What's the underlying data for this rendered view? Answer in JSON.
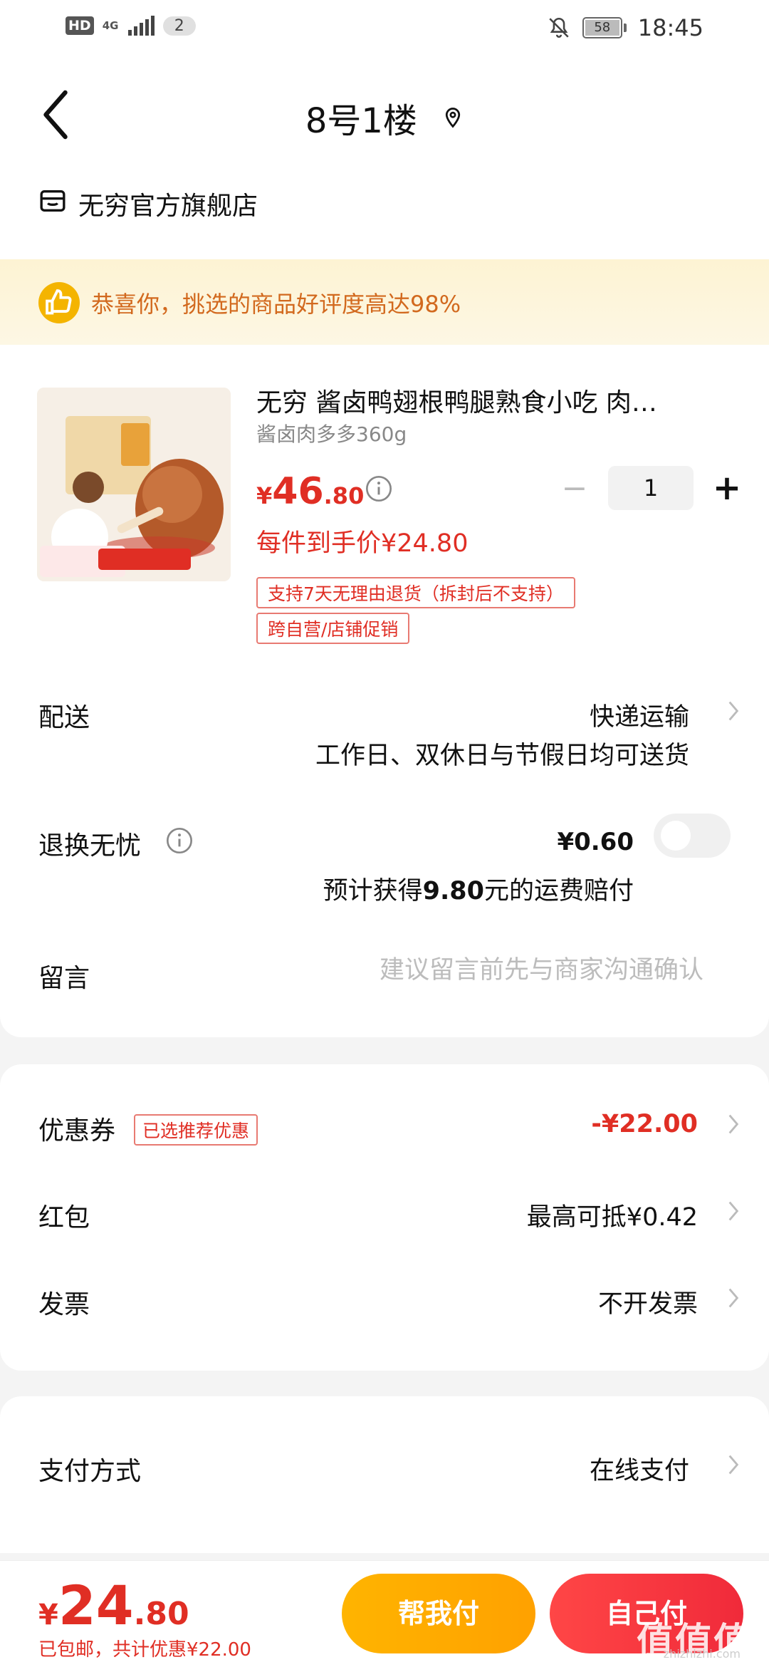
{
  "status_bar": {
    "hd": "HD",
    "network": "4G",
    "notif_count": "2",
    "battery": "58",
    "time": "18:45"
  },
  "header": {
    "title": "8号1楼"
  },
  "store": {
    "name": "无穷官方旗舰店"
  },
  "banner": {
    "text": "恭喜你，挑选的商品好评度高达98%"
  },
  "product": {
    "title": "无穷 酱卤鸭翅根鸭腿熟食小吃 肉…",
    "spec": "酱卤肉多多360g",
    "price_currency": "¥",
    "price_int": "46",
    "price_dec": ".80",
    "quantity": "1",
    "net_price": "每件到手价¥24.80",
    "tags": [
      "支持7天无理由退货（拆封后不支持）",
      "跨自营/店铺促销"
    ]
  },
  "delivery": {
    "label": "配送",
    "method": "快递运输",
    "desc": "工作日、双休日与节假日均可送货"
  },
  "refund": {
    "label": "退换无忧",
    "price": "¥0.60",
    "desc_prefix": "预计获得",
    "desc_amount": "9.80",
    "desc_suffix": "元的运费赔付",
    "enabled": false
  },
  "message": {
    "label": "留言",
    "placeholder": "建议留言前先与商家沟通确认"
  },
  "discounts": {
    "coupon_label": "优惠券",
    "coupon_tag": "已选推荐优惠",
    "coupon_value": "-¥22.00",
    "redpacket_label": "红包",
    "redpacket_value": "最高可抵¥0.42",
    "invoice_label": "发票",
    "invoice_value": "不开发票"
  },
  "payment": {
    "label": "支付方式",
    "value": "在线支付"
  },
  "bottom": {
    "currency": "¥",
    "total_int": "24",
    "total_dec": ".80",
    "sub": "已包邮，共计优惠¥22.00",
    "help_pay": "帮我付",
    "self_pay": "自己付",
    "watermark": "值值值",
    "watermark_sub": "zhizhizhi.com"
  },
  "colors": {
    "accent": "#e02e24",
    "banner_text": "#d2691e",
    "help_btn": "#ffb400",
    "self_btn": "#f02a3a"
  }
}
